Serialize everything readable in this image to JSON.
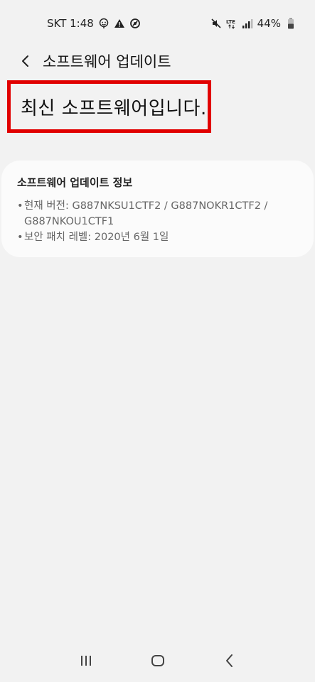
{
  "status_bar": {
    "carrier_time": "SKT 1:48",
    "battery": "44%",
    "network": "LTE"
  },
  "app_bar": {
    "title": "소프트웨어 업데이트"
  },
  "status_message": "최신 소프트웨어입니다.",
  "info_card": {
    "title": "소프트웨어 업데이트 정보",
    "bullet": "•",
    "current_version": "현재 버전: G887NKSU1CTF2 / G887NOKR1CTF2 / G887NKOU1CTF1",
    "security_patch": "보안 패치 레벨: 2020년 6월 1일"
  },
  "colors": {
    "highlight_border": "#e10000",
    "background": "#f2f2f2",
    "card": "#fbfbfb"
  },
  "icons": {
    "back": "chevron-left-icon",
    "nav_recent": "recent-apps-icon",
    "nav_home": "home-icon",
    "nav_back": "back-icon"
  }
}
